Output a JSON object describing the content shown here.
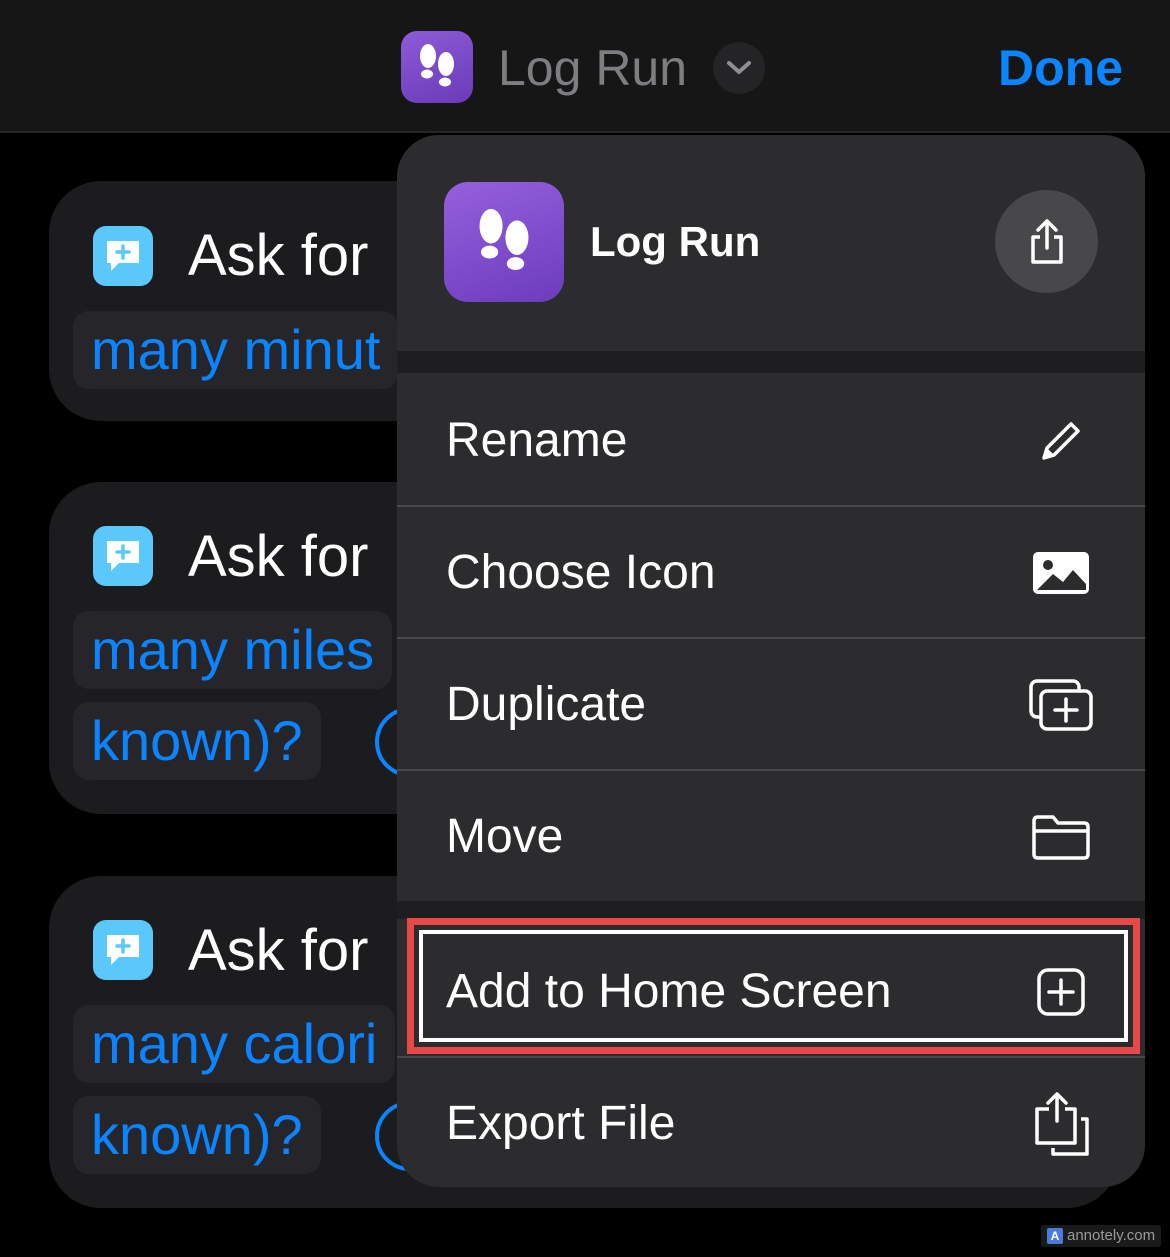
{
  "navbar": {
    "title": "Log Run",
    "done_label": "Done"
  },
  "cards": [
    {
      "label": "Ask for",
      "line1": "many minut",
      "line2": ""
    },
    {
      "label": "Ask for",
      "line1": "many miles",
      "line2": "known)?"
    },
    {
      "label": "Ask for",
      "line1": "many calori",
      "line2": "known)?"
    }
  ],
  "menu": {
    "app_name": "Log Run",
    "items": [
      {
        "label": "Rename",
        "icon": "pencil-icon"
      },
      {
        "label": "Choose Icon",
        "icon": "photo-icon"
      },
      {
        "label": "Duplicate",
        "icon": "duplicate-icon"
      },
      {
        "label": "Move",
        "icon": "folder-icon"
      },
      {
        "label": "Add to Home Screen",
        "icon": "plus-square-icon"
      },
      {
        "label": "Export File",
        "icon": "export-icon"
      }
    ]
  },
  "colors": {
    "accent": "#0a84ff",
    "app_icon": "#7a48c8",
    "ask_icon": "#5ac8fa",
    "highlight": "#e84848"
  },
  "watermark": "annotely.com"
}
